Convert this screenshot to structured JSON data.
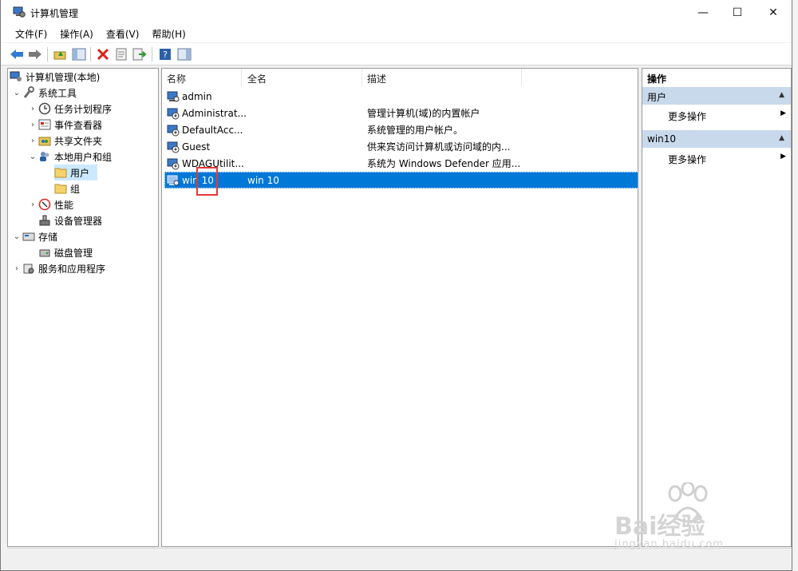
{
  "window": {
    "title": "计算机管理",
    "min": "—",
    "max": "☐",
    "close": "✕"
  },
  "menubar": [
    "文件(F)",
    "操作(A)",
    "查看(V)",
    "帮助(H)"
  ],
  "tree": {
    "root": "计算机管理(本地)",
    "system_tools": "系统工具",
    "task_scheduler": "任务计划程序",
    "event_viewer": "事件查看器",
    "shared_folders": "共享文件夹",
    "local_users_groups": "本地用户和组",
    "users": "用户",
    "groups": "组",
    "performance": "性能",
    "device_manager": "设备管理器",
    "storage": "存储",
    "disk_management": "磁盘管理",
    "services_apps": "服务和应用程序"
  },
  "list": {
    "headers": [
      "名称",
      "全名",
      "描述"
    ],
    "rows": [
      {
        "name": "admin",
        "fullname": "",
        "desc": ""
      },
      {
        "name": "Administrat...",
        "fullname": "",
        "desc": "管理计算机(域)的内置帐户"
      },
      {
        "name": "DefaultAcc...",
        "fullname": "",
        "desc": "系统管理的用户帐户。"
      },
      {
        "name": "Guest",
        "fullname": "",
        "desc": "供来宾访问计算机或访问域的内..."
      },
      {
        "name": "WDAGUtilit...",
        "fullname": "",
        "desc": "系统为 Windows Defender 应用..."
      },
      {
        "name": "win 10",
        "fullname": "win 10",
        "desc": ""
      }
    ]
  },
  "actions": {
    "header": "操作",
    "section1": "用户",
    "more1": "更多操作",
    "section2": "win10",
    "more2": "更多操作"
  },
  "watermark": {
    "brand": "Bai经验",
    "url": "jingyan.baidu.com"
  },
  "colors": {
    "selection": "#0078d7",
    "section_bg": "#c8d9ec",
    "highlight_box": "#e53935"
  }
}
